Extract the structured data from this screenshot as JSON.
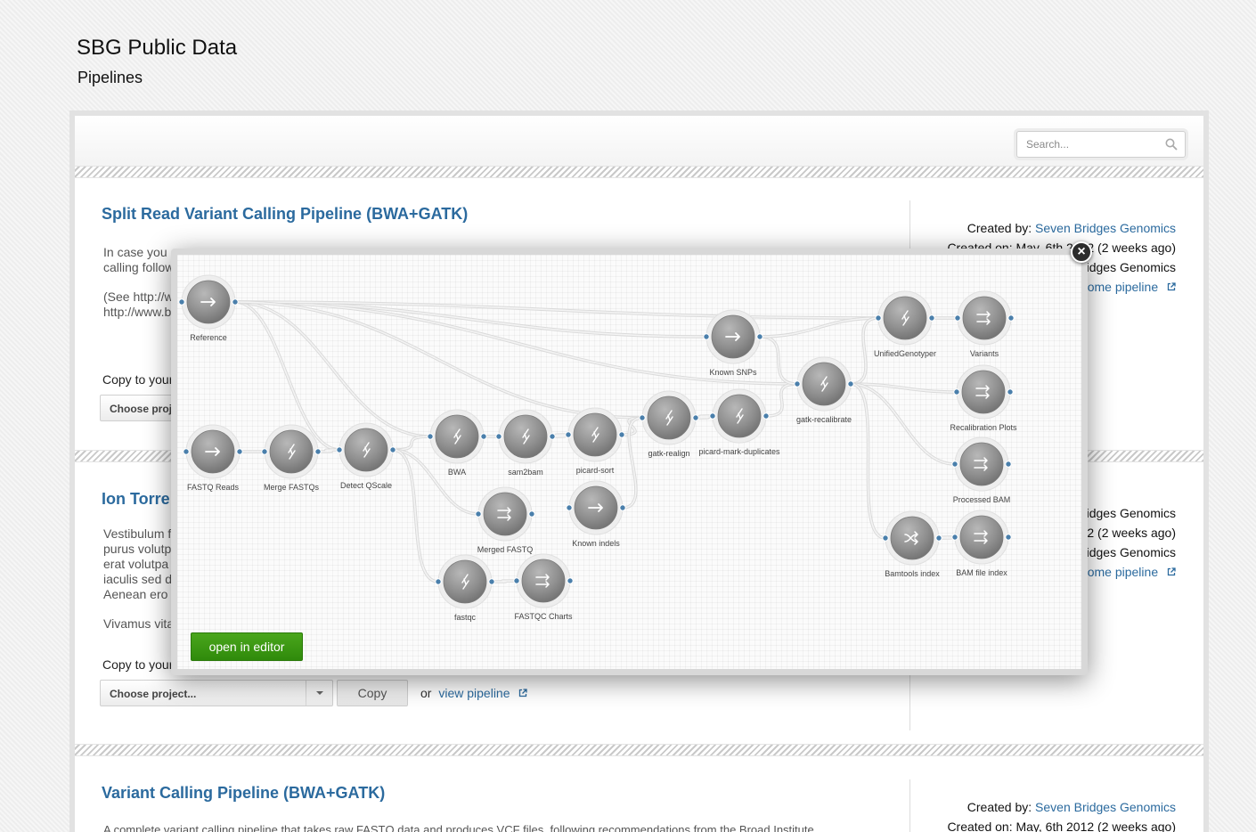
{
  "header": {
    "title": "SBG Public Data",
    "subtitle": "Pipelines"
  },
  "search": {
    "placeholder": "Search..."
  },
  "pipelines": [
    {
      "title": "Split Read Variant Calling Pipeline (BWA+GATK)",
      "desc_lines": [
        "In case you",
        "calling follow",
        "",
        "(See http://w",
        "http://www.b"
      ],
      "copy_label": "Copy to your",
      "select_label": "Choose proj",
      "meta": {
        "created_by_label": "Created by:",
        "created_by": "Seven Bridges Genomics",
        "created_on": "Created on: May, 6th 2012 (2 weeks ago)",
        "link1": "ridges Genomics",
        "link2": "some pipeline"
      }
    },
    {
      "title": "Ion Torre",
      "desc_lines": [
        "Vestibulum f",
        "purus volutp",
        "erat volutpa",
        "iaculis sed d",
        " Aenean ero",
        "",
        "Vivamus vita"
      ],
      "copy_label": "Copy to your",
      "select_label": "Choose project...",
      "copy_btn": "Copy",
      "or_text": "or",
      "view_pipeline": "view pipeline",
      "meta": {
        "link0": "ridges Genomics",
        "date": "12 (2 weeks ago)",
        "link1": "ridges Genomics",
        "link2": "some pipeline"
      }
    },
    {
      "title": "Variant Calling Pipeline (BWA+GATK)",
      "desc_line": "A complete variant calling pipeline that takes raw FASTQ data and produces VCF files, following recommendations from the Broad Institute",
      "meta": {
        "created_by_label": "Created by:",
        "created_by": "Seven Bridges Genomics",
        "created_on": "Created on: May, 6th 2012 (2 weeks ago)"
      }
    }
  ],
  "modal": {
    "close_symbol": "×",
    "open_editor_label": "open in editor",
    "nodes": [
      {
        "id": "reference",
        "label": "Reference",
        "icon": "arrow-right-icon"
      },
      {
        "id": "fastq-reads",
        "label": "FASTQ Reads",
        "icon": "arrow-right-icon"
      },
      {
        "id": "merge-fastqs",
        "label": "Merge FASTQs",
        "icon": "tool-icon"
      },
      {
        "id": "detect-qscale",
        "label": "Detect QScale",
        "icon": "tool-icon"
      },
      {
        "id": "bwa",
        "label": "BWA",
        "icon": "tool-icon"
      },
      {
        "id": "sam2bam",
        "label": "sam2bam",
        "icon": "tool-icon"
      },
      {
        "id": "picard-sort",
        "label": "picard-sort",
        "icon": "tool-icon"
      },
      {
        "id": "gatk-realign",
        "label": "gatk-realign",
        "icon": "tool-icon"
      },
      {
        "id": "picard-mark-duplicates",
        "label": "picard-mark-duplicates",
        "icon": "tool-icon"
      },
      {
        "id": "known-snps",
        "label": "Known SNPs",
        "icon": "arrow-right-icon"
      },
      {
        "id": "gatk-recalibrate",
        "label": "gatk-recalibrate",
        "icon": "tool-icon"
      },
      {
        "id": "unifiedgenotyper",
        "label": "UnifiedGenotyper",
        "icon": "tool-icon"
      },
      {
        "id": "variants",
        "label": "Variants",
        "icon": "output-icon"
      },
      {
        "id": "recalibration-plots",
        "label": "Recalibration Plots",
        "icon": "output-icon"
      },
      {
        "id": "processed-bam",
        "label": "Processed BAM",
        "icon": "output-icon"
      },
      {
        "id": "bamtools-index",
        "label": "Bamtools index",
        "icon": "shuffle-icon"
      },
      {
        "id": "bam-file-index",
        "label": "BAM file index",
        "icon": "output-icon"
      },
      {
        "id": "merged-fastq",
        "label": "Merged FASTQ",
        "icon": "output-icon"
      },
      {
        "id": "known-indels",
        "label": "Known indels",
        "icon": "arrow-right-icon"
      },
      {
        "id": "fastqc",
        "label": "fastqc",
        "icon": "tool-icon"
      },
      {
        "id": "fastqc-charts",
        "label": "FASTQC Charts",
        "icon": "output-icon"
      }
    ]
  },
  "colors": {
    "link": "#2b6a9e",
    "green_button": "#3a961a",
    "node_gray": "#8e8e8e",
    "port_blue": "#4a7fab"
  }
}
